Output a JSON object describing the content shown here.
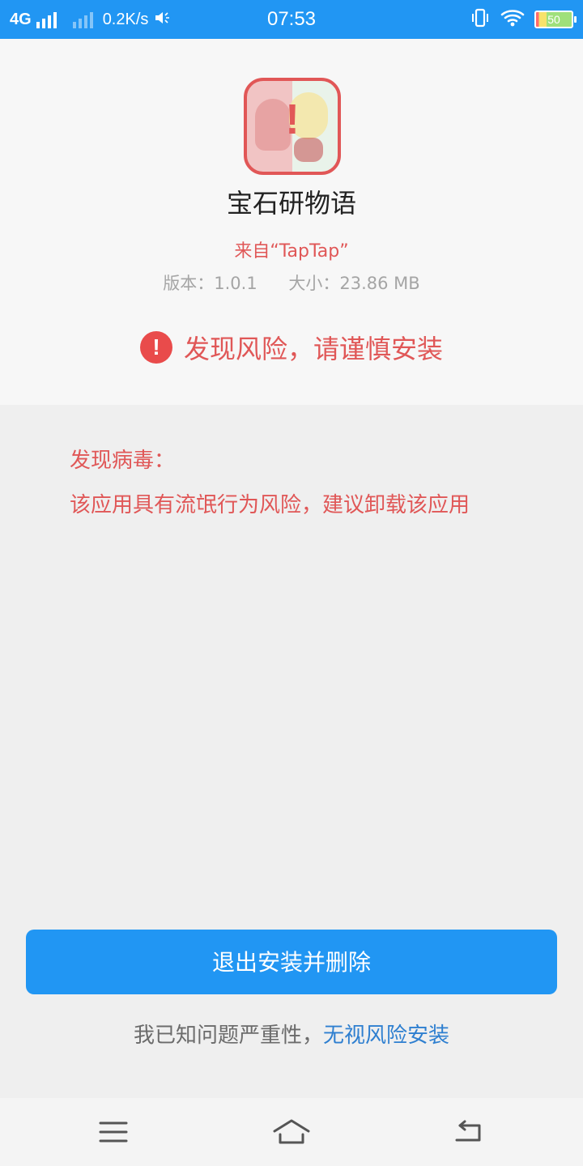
{
  "status_bar": {
    "network": "4G",
    "speed": "0.2K/s",
    "time": "07:53",
    "battery_level": "50",
    "icons": [
      "signal-icon",
      "signal-icon-secondary",
      "volume-icon",
      "vibrate-icon",
      "wifi-icon",
      "battery-icon"
    ]
  },
  "app": {
    "name": "宝石研物语",
    "source": "来自“TapTap”",
    "version": "版本：1.0.1",
    "size": "大小：23.86 MB",
    "icon": "app-icon-with-warning"
  },
  "risk_banner": {
    "icon": "warning-icon",
    "text": "发现风险，请谨慎安装",
    "color": "#e05757"
  },
  "details": {
    "title": "发现病毒：",
    "description": "该应用具有流氓行为风险，建议卸载该应用"
  },
  "actions": {
    "primary_label": "退出安装并删除",
    "ignore_prefix": "我已知问题严重性，",
    "ignore_link": "无视风险安装"
  },
  "nav_bar": {
    "icons": [
      "menu-icon",
      "home-icon",
      "back-icon"
    ]
  },
  "colors": {
    "accent": "#2196f3",
    "danger": "#e05757",
    "link": "#2e7fd0"
  }
}
